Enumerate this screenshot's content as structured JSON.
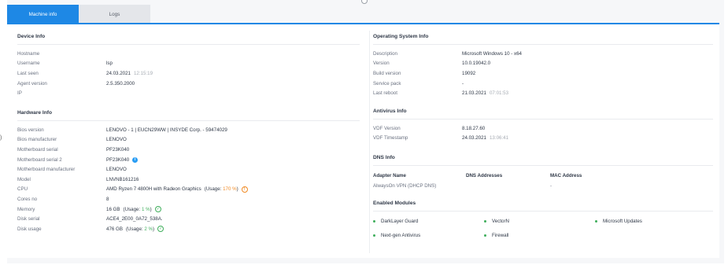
{
  "tabs": [
    {
      "label": "Machine info",
      "active": true
    },
    {
      "label": "Logs",
      "active": false
    }
  ],
  "colors": {
    "accent": "#1e88e5",
    "ok": "#3fae5b",
    "warn": "#f08a24",
    "info": "#2a9df4"
  },
  "device_info": {
    "title": "Device Info",
    "rows": [
      {
        "key": "Hostname",
        "value": ""
      },
      {
        "key": "Username",
        "value": "lsp"
      },
      {
        "key": "Last seen",
        "value": "24.03.2021",
        "extra": "12:15:19"
      },
      {
        "key": "Agent version",
        "value": "2.5.350.2000"
      },
      {
        "key": "IP",
        "value": ""
      }
    ]
  },
  "hardware_info": {
    "title": "Hardware Info",
    "rows": [
      {
        "key": "Bios version",
        "value": "LENOVO - 1 | EUCN29WW | INSYDE Corp. - 59474029"
      },
      {
        "key": "Bios manufacturer",
        "value": "LENOVO"
      },
      {
        "key": "Motherboard serial",
        "value": "PF23K040"
      },
      {
        "key": "Motherboard serial 2",
        "value": "PF23K040",
        "icon": "info-icon"
      },
      {
        "key": "Motherboard manufacturer",
        "value": "LENOVO"
      },
      {
        "key": "Model",
        "value": "LNVNB161216"
      },
      {
        "key": "CPU",
        "value": "AMD Ryzen 7 4800H with Radeon Graphics",
        "usage_prefix": "(Usage: ",
        "usage": "170 %",
        "usage_suffix": ")",
        "icon": "warning-icon"
      },
      {
        "key": "Cores no",
        "value": "8"
      },
      {
        "key": "Memory",
        "value": "16 GB",
        "usage_prefix": "(Usage: ",
        "usage": "1 %",
        "usage_suffix": ")",
        "icon": "check-icon"
      },
      {
        "key": "Disk serial",
        "value": "ACE4_2E00_0A72_538A."
      },
      {
        "key": "Disk usage",
        "value": "476 GB",
        "usage_prefix": "(Usage: ",
        "usage": "2 %",
        "usage_suffix": ")",
        "icon": "check-icon"
      }
    ]
  },
  "os_info": {
    "title": "Operating System Info",
    "rows": [
      {
        "key": "Description",
        "value": "Microsoft Windows 10 - x64"
      },
      {
        "key": "Version",
        "value": "10.0.19042.0"
      },
      {
        "key": "Build version",
        "value": "19092"
      },
      {
        "key": "Service pack",
        "value": "-"
      },
      {
        "key": "Last reboot",
        "value": "21.03.2021",
        "extra": "07:01:53"
      }
    ]
  },
  "antivirus_info": {
    "title": "Antivirus Info",
    "rows": [
      {
        "key": "VDF Version",
        "value": "8.18.27.60"
      },
      {
        "key": "VDF Timestamp",
        "value": "24.03.2021",
        "extra": "13:06:41"
      }
    ]
  },
  "dns_info": {
    "title": "DNS Info",
    "headers": [
      "Adapter Name",
      "DNS Addresses",
      "MAC Address"
    ],
    "rows": [
      {
        "adapter": "AlwaysOn VPN (DHCP DNS)",
        "dns": "",
        "mac": "-"
      }
    ]
  },
  "enabled_modules": {
    "title": "Enabled Modules",
    "items": [
      "DarkLayer Guard",
      "VectorN",
      "Microsoft Updates",
      "Next-gen Antivirus",
      "Firewall"
    ]
  }
}
